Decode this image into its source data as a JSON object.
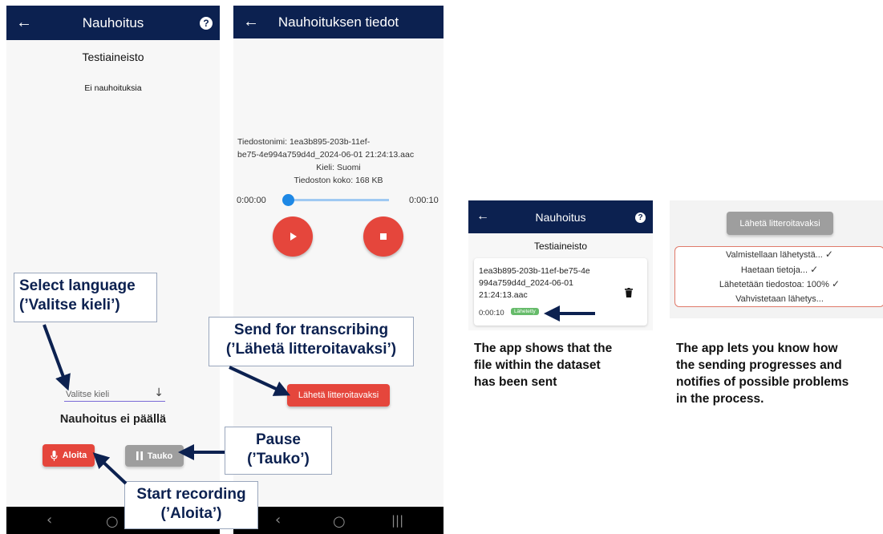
{
  "phone1": {
    "title": "Nauhoitus",
    "dataset_name": "Testiaineisto",
    "empty_text": "Ei nauhoituksia",
    "language_placeholder": "Valitse kieli",
    "status": "Nauhoitus ei päällä",
    "start_label": "Aloita",
    "pause_label": "Tauko"
  },
  "phone2": {
    "title": "Nauhoituksen tiedot",
    "file_line1": "Tiedostonimi: 1ea3b895-203b-11ef-",
    "file_line2": "be75-4e994a759d4d_2024-06-01 21:24:13.aac",
    "language_line": "Kieli:  Suomi",
    "size_line": "Tiedoston koko: 168 KB",
    "time_start": "0:00:00",
    "time_end": "0:00:10",
    "playback_progress": 0.0,
    "send_label": "Lähetä litteroitavaksi"
  },
  "callouts": {
    "select_language": [
      "Select language",
      "(’Valitse kieli’)"
    ],
    "send": [
      "Send for transcribing",
      "(’Lähetä litteroitavaksi’)"
    ],
    "pause": [
      "Pause",
      "(’Tauko’)"
    ],
    "start": [
      "Start recording",
      "(’Aloita’)"
    ]
  },
  "phone3": {
    "title": "Nauhoitus",
    "dataset_name": "Testiaineisto",
    "file_line1": "1ea3b895-203b-11ef-be75-4e",
    "file_line2": "994a759d4d_2024-06-01",
    "file_line3": "21:24:13.aac",
    "duration": "0:00:10",
    "sent_badge": "Lähetetty"
  },
  "panel4": {
    "send_label": "Lähetä litteroitavaksi",
    "steps": [
      "Valmistellaan lähetystä...",
      "Haetaan tietoja...",
      "Lähetetään tiedostoa: 100%",
      "Vahvistetaan lähetys..."
    ]
  },
  "captions": {
    "sent": [
      "The app shows that the",
      "file within the dataset",
      "has been sent"
    ],
    "progress": [
      "The app lets you know how",
      "the sending progresses and",
      "notifies of possible problems",
      "in the process."
    ]
  },
  "colors": {
    "appbar": "#0c2150",
    "accent_red": "#e5463c",
    "slider_blue": "#1e88e5",
    "sent_green": "#66bb6a",
    "progress_border": "#e07a6a"
  },
  "icons": [
    "back-arrow-icon",
    "help-icon",
    "mic-icon",
    "pause-icon",
    "play-icon",
    "stop-icon",
    "trash-icon",
    "chevron-down-icon",
    "check-icon"
  ]
}
